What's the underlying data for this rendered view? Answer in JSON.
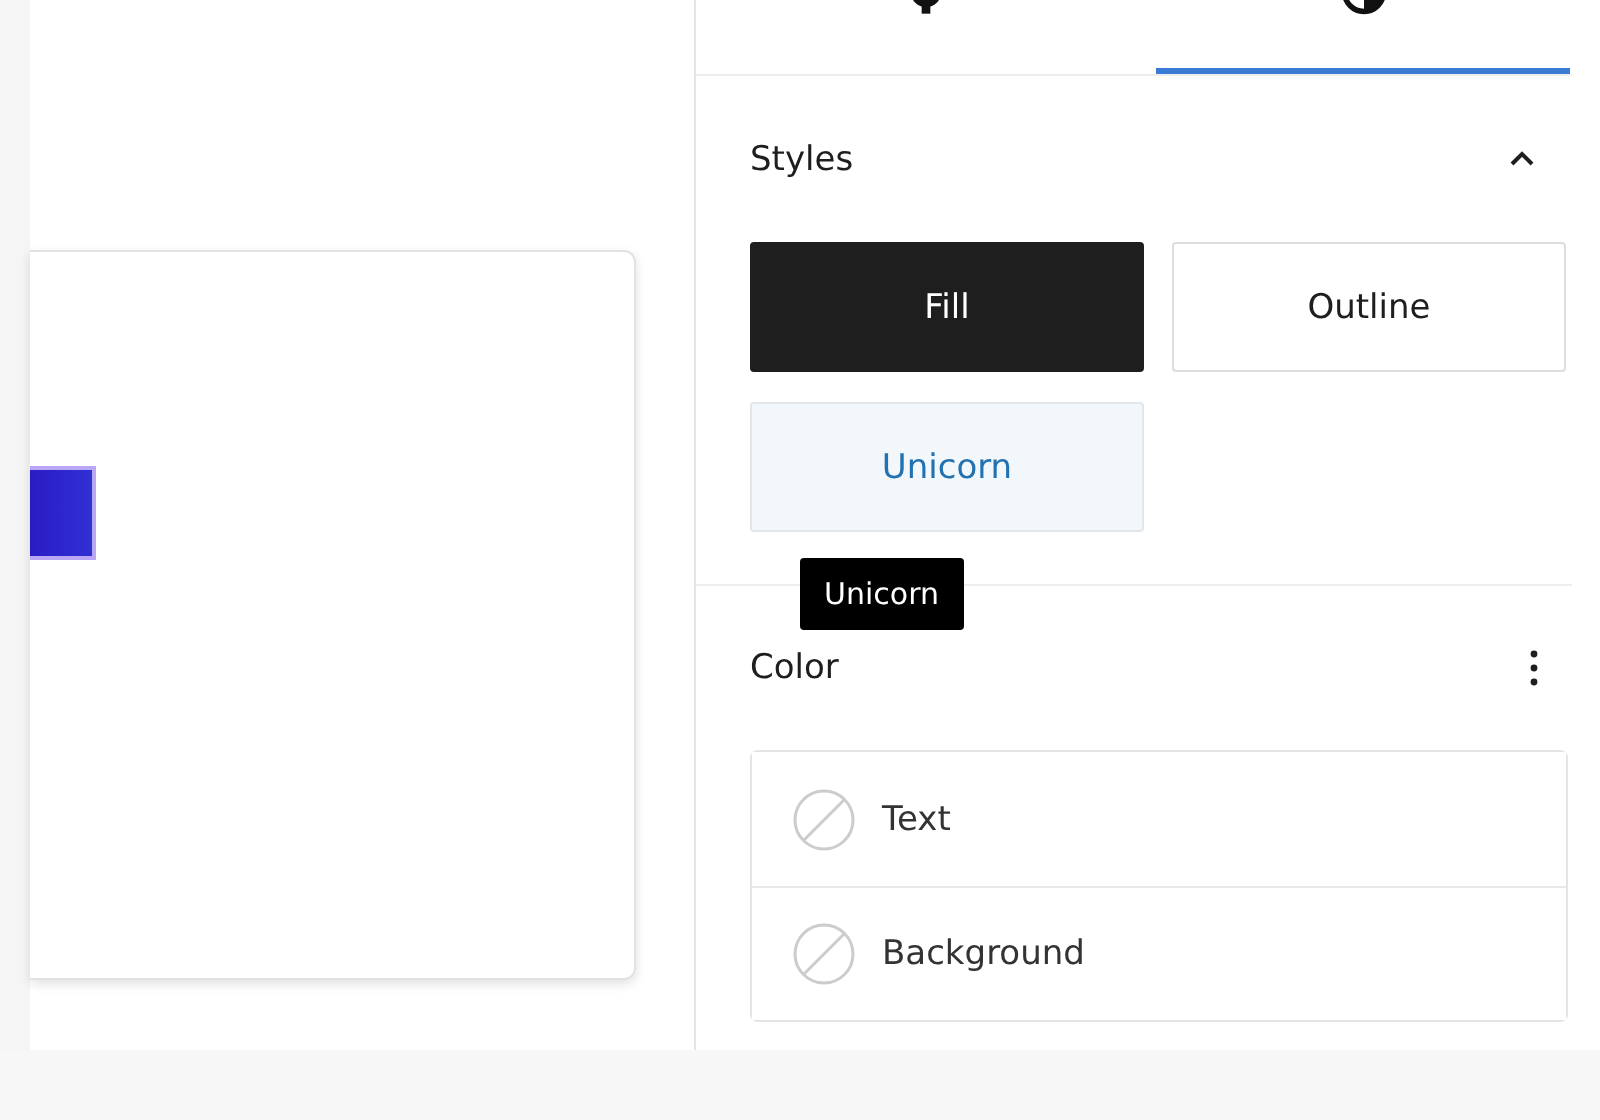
{
  "tabs": [
    {
      "kind": "settings",
      "selected": false
    },
    {
      "kind": "styles",
      "selected": true
    }
  ],
  "styles": {
    "title": "Styles",
    "expanded": true,
    "variants": [
      {
        "label": "Fill",
        "selected": true,
        "hovered": false
      },
      {
        "label": "Outline",
        "selected": false,
        "hovered": false
      },
      {
        "label": "Unicorn",
        "selected": false,
        "hovered": true
      }
    ],
    "tooltip": "Unicorn"
  },
  "color": {
    "title": "Color",
    "items": [
      {
        "label": "Text"
      },
      {
        "label": "Background"
      }
    ]
  }
}
